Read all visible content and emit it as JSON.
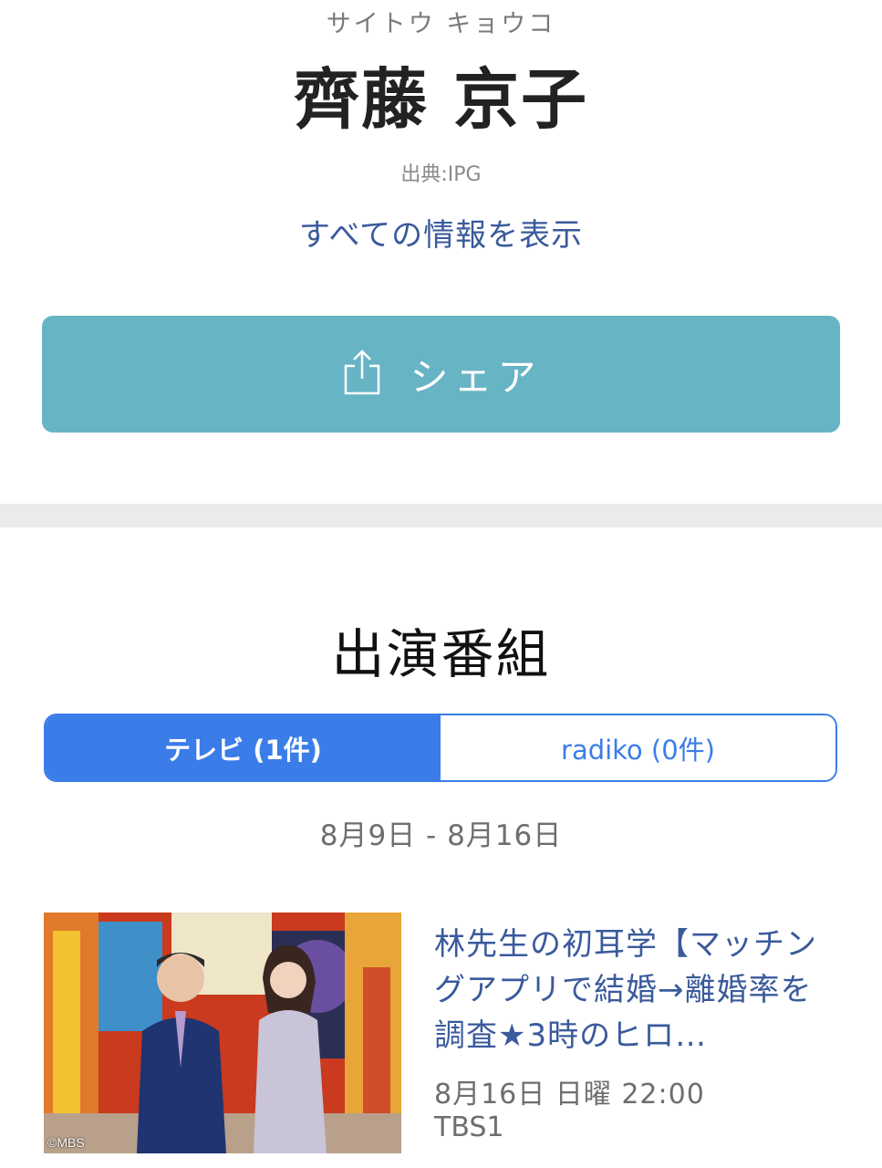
{
  "profile": {
    "kana": "サイトウ キョウコ",
    "name": "齊藤 京子",
    "source": "出典:IPG",
    "show_all_label": "すべての情報を表示"
  },
  "share": {
    "label": "シェア",
    "icon": "share-upload-icon"
  },
  "appearances": {
    "title": "出演番組",
    "tabs": [
      {
        "label": "テレビ (1件)",
        "active": true
      },
      {
        "label": "radiko (0件)",
        "active": false
      }
    ],
    "date_range": "8月9日 - 8月16日",
    "programs": [
      {
        "title": "林先生の初耳学【マッチングアプリで結婚→離婚率を調査★3時のヒロ…",
        "datetime": "8月16日 日曜 22:00",
        "channel": "TBS1",
        "image_credit": "©MBS"
      }
    ]
  },
  "colors": {
    "accent_blue": "#3a7de9",
    "link_blue": "#3a5a9c",
    "share_teal": "#67b4c5",
    "divider_gray": "#ebebeb"
  }
}
